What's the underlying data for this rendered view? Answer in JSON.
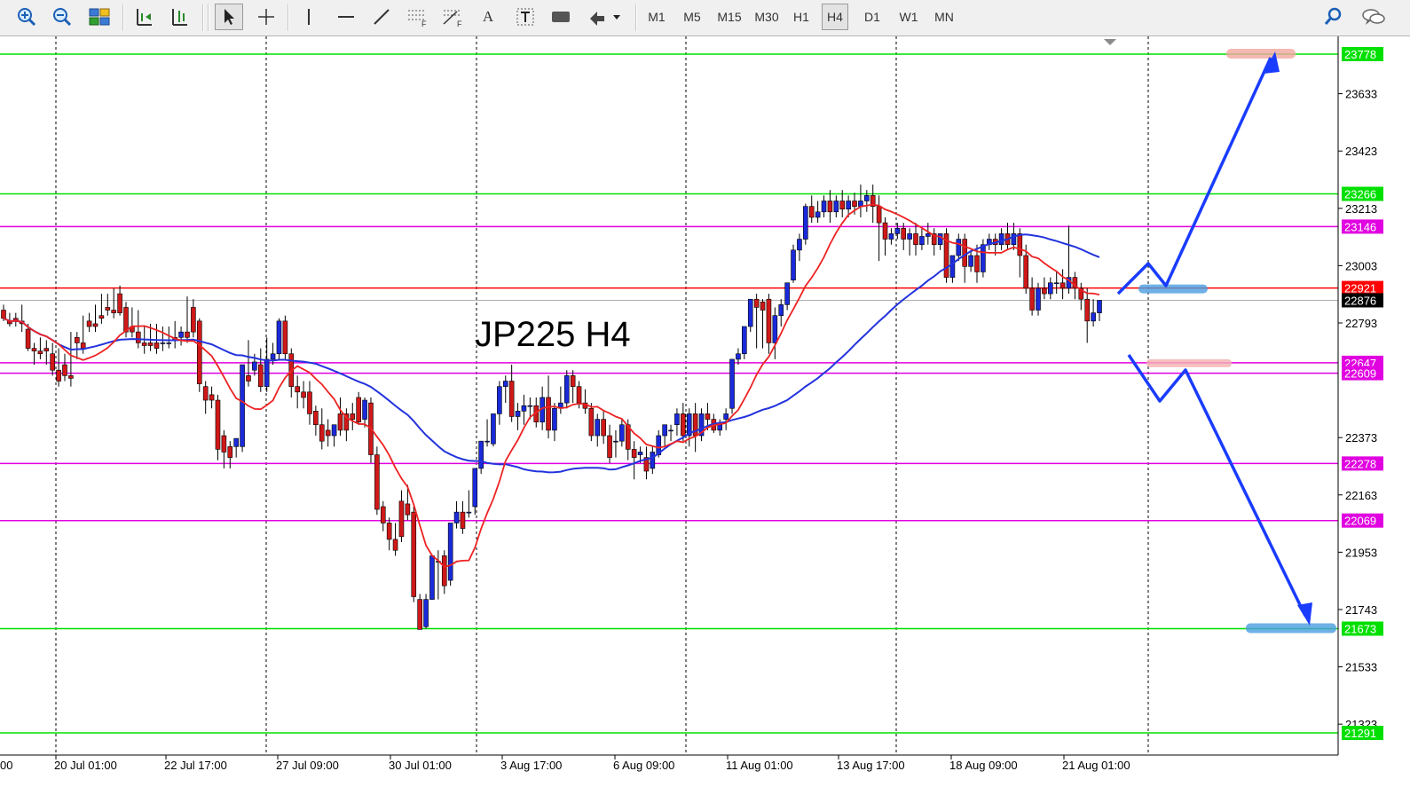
{
  "toolbar": {
    "timeframes": [
      "M1",
      "M5",
      "M15",
      "M30",
      "H1",
      "H4",
      "D1",
      "W1",
      "MN"
    ],
    "active_timeframe": "H4",
    "icons": [
      "zoom-in-icon",
      "zoom-out-icon",
      "tile-windows-icon",
      "chart-shift-icon",
      "autoscroll-icon",
      "cursor-icon",
      "crosshair-icon",
      "vertical-line-icon",
      "horizontal-line-icon",
      "trendline-icon",
      "equidistant-channel-icon",
      "fibonacci-icon",
      "text-icon",
      "text-label-icon",
      "rectangle-icon",
      "arrows-icon",
      "search-icon",
      "chat-icon"
    ],
    "text_tool_label": "A"
  },
  "chart_data": {
    "type": "candlestick",
    "title": "JP225 H4",
    "symbol": "JP225",
    "timeframe": "H4",
    "ylim": [
      21250,
      23800
    ],
    "price_ticks": [
      23633,
      23423,
      23213,
      23003,
      22793,
      22373,
      22163,
      21953,
      21743,
      21533,
      21323
    ],
    "time_ticks": [
      "20 Jul 01:00",
      "22 Jul 17:00",
      "27 Jul 09:00",
      "30 Jul 01:00",
      "3 Aug 17:00",
      "6 Aug 09:00",
      "11 Aug 01:00",
      "13 Aug 17:00",
      "18 Aug 09:00",
      "21 Aug 01:00"
    ],
    "time_tick_cut": "00",
    "horizontal_levels": [
      {
        "price": 23778,
        "label": "23778",
        "color": "#00e000"
      },
      {
        "price": 23266,
        "label": "23266",
        "color": "#00e000"
      },
      {
        "price": 23146,
        "label": "23146",
        "color": "#e000e0"
      },
      {
        "price": 22921,
        "label": "22921",
        "color": "#ff0000"
      },
      {
        "price": 22647,
        "label": "22647",
        "color": "#e000e0"
      },
      {
        "price": 22609,
        "label": "22609",
        "color": "#e000e0"
      },
      {
        "price": 22278,
        "label": "22278",
        "color": "#e000e0"
      },
      {
        "price": 22069,
        "label": "22069",
        "color": "#e000e0"
      },
      {
        "price": 21673,
        "label": "21673",
        "color": "#00e000"
      },
      {
        "price": 21291,
        "label": "21291",
        "color": "#00e000"
      }
    ],
    "current_price": {
      "price": 22876,
      "label": "22876"
    },
    "candles": [
      [
        22840,
        22860,
        22810,
        22800
      ],
      [
        22800,
        22830,
        22790,
        22780
      ],
      [
        22810,
        22830,
        22800,
        22780
      ],
      [
        22800,
        22860,
        22790,
        22760
      ],
      [
        22770,
        22790,
        22700,
        22690
      ],
      [
        22700,
        22720,
        22690,
        22640
      ],
      [
        22690,
        22740,
        22680,
        22660
      ],
      [
        22700,
        22730,
        22690,
        22640
      ],
      [
        22680,
        22720,
        22620,
        22600
      ],
      [
        22620,
        22700,
        22580,
        22560
      ],
      [
        22640,
        22680,
        22600,
        22580
      ],
      [
        22600,
        22760,
        22590,
        22560
      ],
      [
        22740,
        22760,
        22720,
        22660
      ],
      [
        22720,
        22820,
        22700,
        22680
      ],
      [
        22800,
        22830,
        22780,
        22760
      ],
      [
        22790,
        22860,
        22780,
        22760
      ],
      [
        22820,
        22900,
        22810,
        22790
      ],
      [
        22850,
        22900,
        22840,
        22820
      ],
      [
        22840,
        22920,
        22830,
        22810
      ],
      [
        22900,
        22930,
        22830,
        22820
      ],
      [
        22850,
        22870,
        22760,
        22740
      ],
      [
        22780,
        22850,
        22760,
        22740
      ],
      [
        22760,
        22840,
        22720,
        22700
      ],
      [
        22720,
        22780,
        22710,
        22680
      ],
      [
        22720,
        22790,
        22710,
        22690
      ],
      [
        22720,
        22790,
        22700,
        22680
      ],
      [
        22720,
        22780,
        22720,
        22690
      ],
      [
        22720,
        22780,
        22720,
        22700
      ],
      [
        22740,
        22800,
        22730,
        22700
      ],
      [
        22740,
        22780,
        22760,
        22710
      ],
      [
        22760,
        22890,
        22740,
        22720
      ],
      [
        22850,
        22880,
        22760,
        22740
      ],
      [
        22800,
        22810,
        22570,
        22540
      ],
      [
        22560,
        22580,
        22510,
        22460
      ],
      [
        22530,
        22560,
        22510,
        22480
      ],
      [
        22510,
        22530,
        22330,
        22290
      ],
      [
        22380,
        22400,
        22320,
        22260
      ],
      [
        22340,
        22360,
        22300,
        22260
      ],
      [
        22340,
        22360,
        22370,
        22300
      ],
      [
        22340,
        22360,
        22640,
        22320
      ],
      [
        22600,
        22730,
        22580,
        22560
      ],
      [
        22620,
        22680,
        22650,
        22600
      ],
      [
        22640,
        22700,
        22560,
        22540
      ],
      [
        22560,
        22740,
        22660,
        22540
      ],
      [
        22660,
        22720,
        22680,
        22640
      ],
      [
        22680,
        22810,
        22800,
        22660
      ],
      [
        22800,
        22820,
        22680,
        22660
      ],
      [
        22680,
        22700,
        22560,
        22520
      ],
      [
        22560,
        22600,
        22540,
        22480
      ],
      [
        22540,
        22580,
        22520,
        22480
      ],
      [
        22540,
        22580,
        22460,
        22420
      ],
      [
        22470,
        22490,
        22420,
        22380
      ],
      [
        22420,
        22480,
        22360,
        22330
      ],
      [
        22400,
        22440,
        22380,
        22340
      ],
      [
        22380,
        22420,
        22420,
        22340
      ],
      [
        22460,
        22520,
        22400,
        22380
      ],
      [
        22460,
        22480,
        22400,
        22360
      ],
      [
        22460,
        22500,
        22440,
        22400
      ],
      [
        22520,
        22540,
        22430,
        22420
      ],
      [
        22440,
        22520,
        22510,
        22410
      ],
      [
        22500,
        22520,
        22310,
        22280
      ],
      [
        22310,
        22340,
        22110,
        22090
      ],
      [
        22120,
        22140,
        22060,
        22030
      ],
      [
        22060,
        22080,
        22000,
        21960
      ],
      [
        22000,
        22060,
        21960,
        21940
      ],
      [
        22140,
        22180,
        22010,
        21990
      ],
      [
        22130,
        22200,
        22090,
        22070
      ],
      [
        22100,
        22120,
        21790,
        21770
      ],
      [
        21780,
        21800,
        21670,
        21673
      ],
      [
        21680,
        21800,
        21780,
        21673
      ],
      [
        21780,
        21930,
        21940,
        21780
      ],
      [
        21920,
        21960,
        21920,
        21780
      ],
      [
        21940,
        21960,
        21830,
        21800
      ],
      [
        21850,
        21960,
        22060,
        21830
      ],
      [
        22060,
        22140,
        22100,
        22040
      ],
      [
        22100,
        22140,
        22040,
        22020
      ],
      [
        22100,
        22180,
        22100,
        22080
      ],
      [
        22120,
        22260,
        22260,
        22090
      ],
      [
        22260,
        22300,
        22360,
        22240
      ],
      [
        22360,
        22440,
        22360,
        22340
      ],
      [
        22350,
        22440,
        22460,
        22340
      ],
      [
        22460,
        22580,
        22560,
        22420
      ],
      [
        22560,
        22600,
        22580,
        22500
      ],
      [
        22580,
        22640,
        22450,
        22430
      ],
      [
        22450,
        22500,
        22470,
        22400
      ],
      [
        22470,
        22530,
        22490,
        22420
      ],
      [
        22490,
        22520,
        22490,
        22440
      ],
      [
        22490,
        22520,
        22430,
        22410
      ],
      [
        22430,
        22560,
        22520,
        22400
      ],
      [
        22520,
        22600,
        22400,
        22370
      ],
      [
        22400,
        22500,
        22480,
        22360
      ],
      [
        22480,
        22560,
        22500,
        22460
      ],
      [
        22500,
        22620,
        22600,
        22480
      ],
      [
        22600,
        22620,
        22560,
        22500
      ],
      [
        22560,
        22580,
        22500,
        22480
      ],
      [
        22500,
        22550,
        22480,
        22460
      ],
      [
        22480,
        22500,
        22380,
        22360
      ],
      [
        22380,
        22460,
        22440,
        22340
      ],
      [
        22440,
        22470,
        22380,
        22350
      ],
      [
        22380,
        22420,
        22300,
        22280
      ],
      [
        22360,
        22400,
        22360,
        22300
      ],
      [
        22360,
        22440,
        22420,
        22340
      ],
      [
        22420,
        22440,
        22330,
        22290
      ],
      [
        22330,
        22360,
        22300,
        22220
      ],
      [
        22310,
        22340,
        22320,
        22280
      ],
      [
        22300,
        22340,
        22250,
        22220
      ],
      [
        22260,
        22340,
        22320,
        22240
      ],
      [
        22310,
        22400,
        22380,
        22300
      ],
      [
        22380,
        22420,
        22420,
        22340
      ],
      [
        22400,
        22420,
        22400,
        22360
      ],
      [
        22420,
        22480,
        22460,
        22380
      ],
      [
        22460,
        22500,
        22380,
        22360
      ],
      [
        22380,
        22480,
        22460,
        22340
      ],
      [
        22460,
        22500,
        22380,
        22320
      ],
      [
        22380,
        22480,
        22460,
        22360
      ],
      [
        22460,
        22500,
        22440,
        22400
      ],
      [
        22440,
        22460,
        22400,
        22390
      ],
      [
        22400,
        22440,
        22420,
        22380
      ],
      [
        22440,
        22480,
        22460,
        22400
      ],
      [
        22480,
        22600,
        22660,
        22460
      ],
      [
        22660,
        22700,
        22680,
        22640
      ],
      [
        22680,
        22760,
        22780,
        22660
      ],
      [
        22780,
        22880,
        22880,
        22760
      ],
      [
        22880,
        22900,
        22850,
        22700
      ],
      [
        22870,
        22880,
        22840,
        22700
      ],
      [
        22880,
        22900,
        22720,
        22680
      ],
      [
        22720,
        22850,
        22820,
        22660
      ],
      [
        22820,
        22880,
        22860,
        22780
      ],
      [
        22860,
        22940,
        22940,
        22840
      ],
      [
        22950,
        23080,
        23060,
        22940
      ],
      [
        23060,
        23120,
        23100,
        23020
      ],
      [
        23100,
        23230,
        23220,
        23080
      ],
      [
        23220,
        23260,
        23180,
        23160
      ],
      [
        23180,
        23240,
        23200,
        23160
      ],
      [
        23200,
        23260,
        23240,
        23180
      ],
      [
        23240,
        23280,
        23200,
        23160
      ],
      [
        23200,
        23260,
        23240,
        23180
      ],
      [
        23240,
        23280,
        23210,
        23180
      ],
      [
        23210,
        23260,
        23240,
        23180
      ],
      [
        23240,
        23270,
        23220,
        23190
      ],
      [
        23220,
        23300,
        23240,
        23180
      ],
      [
        23240,
        23280,
        23260,
        23200
      ],
      [
        23260,
        23300,
        23220,
        23160
      ],
      [
        23220,
        23260,
        23160,
        23020
      ],
      [
        23160,
        23180,
        23100,
        23040
      ],
      [
        23100,
        23140,
        23120,
        23080
      ],
      [
        23120,
        23160,
        23140,
        23100
      ],
      [
        23140,
        23160,
        23100,
        23060
      ],
      [
        23100,
        23140,
        23120,
        23040
      ],
      [
        23120,
        23160,
        23080,
        23040
      ],
      [
        23080,
        23140,
        23110,
        23060
      ],
      [
        23110,
        23160,
        23120,
        23080
      ],
      [
        23120,
        23140,
        23080,
        23040
      ],
      [
        23080,
        23120,
        23120,
        23060
      ],
      [
        23120,
        23140,
        22960,
        22940
      ],
      [
        22960,
        23020,
        23040,
        22940
      ],
      [
        23040,
        23120,
        23100,
        23020
      ],
      [
        23100,
        23120,
        23000,
        22940
      ],
      [
        23000,
        23060,
        23040,
        22980
      ],
      [
        23040,
        23080,
        22980,
        22940
      ],
      [
        22980,
        23100,
        23080,
        22960
      ],
      [
        23080,
        23120,
        23100,
        23060
      ],
      [
        23100,
        23120,
        23080,
        23040
      ],
      [
        23080,
        23140,
        23120,
        23060
      ],
      [
        23120,
        23160,
        23080,
        23060
      ],
      [
        23080,
        23160,
        23120,
        23060
      ],
      [
        23120,
        23140,
        23040,
        22960
      ],
      [
        23040,
        23080,
        22920,
        22900
      ],
      [
        22920,
        22960,
        22840,
        22820
      ],
      [
        22840,
        22940,
        22920,
        22820
      ],
      [
        22920,
        22960,
        22900,
        22880
      ],
      [
        22900,
        22960,
        22940,
        22880
      ],
      [
        22940,
        22980,
        22940,
        22900
      ],
      [
        22940,
        22990,
        22920,
        22880
      ],
      [
        22920,
        23150,
        22960,
        22900
      ],
      [
        22960,
        22980,
        22920,
        22880
      ],
      [
        22920,
        22940,
        22880,
        22840
      ],
      [
        22880,
        22920,
        22800,
        22720
      ],
      [
        22800,
        22880,
        22830,
        22780
      ],
      [
        22830,
        22860,
        22876,
        22800
      ]
    ],
    "ma_red_name": "",
    "ma_blue_name": "",
    "annotation_shapes": [
      {
        "type": "arrow",
        "color": "#1a3cff",
        "from_price": 22900,
        "to_price": 23778,
        "label": ""
      },
      {
        "type": "arrow",
        "color": "#1a3cff",
        "from_price": 22680,
        "to_price": 21673,
        "label": ""
      }
    ]
  }
}
